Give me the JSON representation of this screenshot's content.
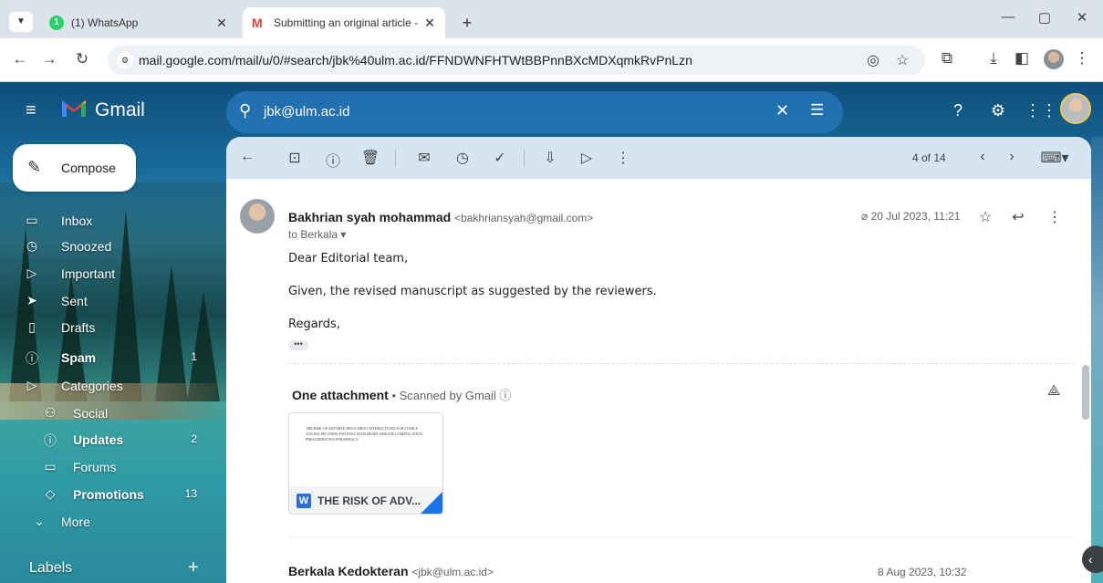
{
  "browser": {
    "tabs": [
      {
        "title": "(1) WhatsApp",
        "close": "✕"
      },
      {
        "title": "Submitting an original article - ",
        "close": "✕"
      }
    ],
    "whatsapp_badge": "1",
    "new_tab": "+",
    "url": "mail.google.com/mail/u/0/#search/jbk%40ulm.ac.id/FFNDWNFHTWtBBPnnBXcMDXqmkRvPnLzn",
    "window_controls": {
      "minimize": "—",
      "restore": "▢",
      "close": "✕"
    }
  },
  "gmail": {
    "brand": "Gmail",
    "search_query": "jbk@ulm.ac.id",
    "compose_label": "Compose",
    "nav": [
      {
        "label": "Inbox",
        "icon": "inbox-icon",
        "glyph": "▭",
        "count": ""
      },
      {
        "label": "Snoozed",
        "icon": "clock-icon",
        "glyph": "◷",
        "count": ""
      },
      {
        "label": "Important",
        "icon": "important-icon",
        "glyph": "▷",
        "count": ""
      },
      {
        "label": "Sent",
        "icon": "send-icon",
        "glyph": "➤",
        "count": ""
      },
      {
        "label": "Drafts",
        "icon": "draft-icon",
        "glyph": "▯",
        "count": ""
      },
      {
        "label": "Spam",
        "icon": "spam-icon",
        "glyph": "ⓘ",
        "count": "1"
      },
      {
        "label": "Categories",
        "icon": "label-icon",
        "glyph": "▷",
        "count": ""
      }
    ],
    "categories": [
      {
        "label": "Social",
        "icon": "people-icon",
        "glyph": "⚇",
        "count": ""
      },
      {
        "label": "Updates",
        "icon": "info-icon",
        "glyph": "ⓘ",
        "count": "2"
      },
      {
        "label": "Forums",
        "icon": "forum-icon",
        "glyph": "▭",
        "count": ""
      },
      {
        "label": "Promotions",
        "icon": "tag-icon",
        "glyph": "◇",
        "count": "13"
      }
    ],
    "more_label": "More",
    "labels_header": "Labels",
    "labels_add": "+"
  },
  "message": {
    "pager": "4 of 14",
    "sender_name": "Bakhrian syah mohammad",
    "sender_email": "<bakhriansyah@gmail.com>",
    "to": "to Berkala",
    "date": "20 Jul 2023, 11:21",
    "body": [
      "Dear Editorial team,",
      "Given, the revised manuscript as suggested by the reviewers.",
      "Regards,"
    ],
    "attachment_title": "One attachment",
    "attachment_scan": " • Scanned by Gmail ⓘ",
    "attachment_name": "THE RISK OF ADV...",
    "attachment_preview": "THE RISK OF ADVERSE DRUG-DRUG INTERACTIONS FOR STABLE ANGINA PECTORIS PATIENTS WITH HEART DISEASE COMPLICATION PRESCRIBED POLYPHARMACY",
    "attachment_badge": "W"
  },
  "next_message": {
    "sender_name": "Berkala Kedokteran",
    "sender_email": "<jbk@ulm.ac.id>",
    "date": "8 Aug 2023, 10:32"
  }
}
